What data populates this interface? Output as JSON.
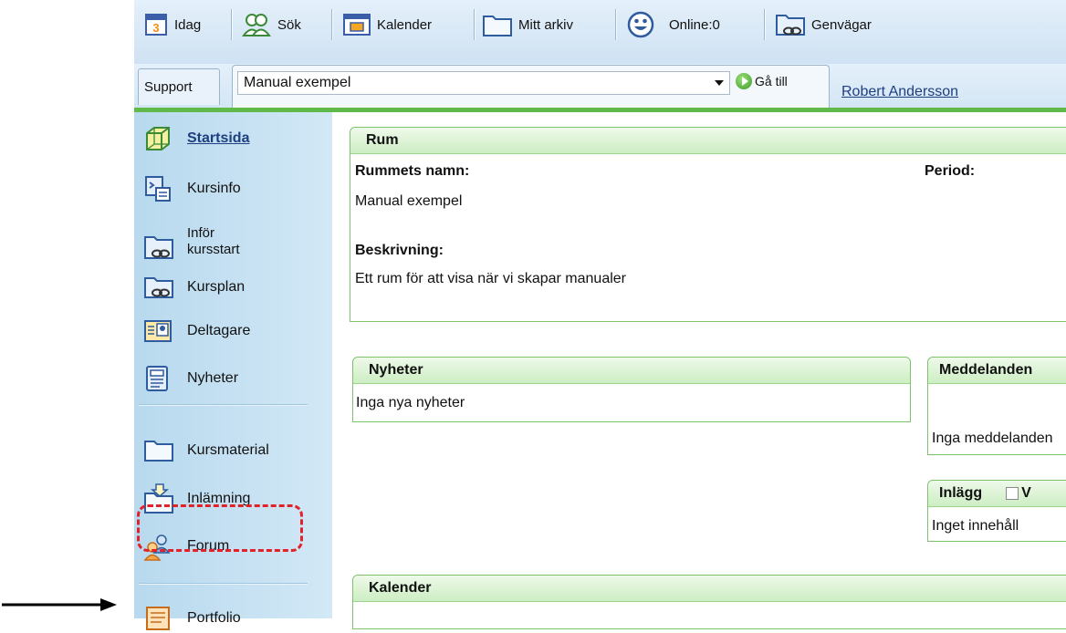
{
  "toolbar": {
    "items": [
      {
        "label": "Idag",
        "icon": "calendar-day-icon"
      },
      {
        "label": "Sök",
        "icon": "people-search-icon"
      },
      {
        "label": "Kalender",
        "icon": "calendar-icon"
      },
      {
        "label": "Mitt arkiv",
        "icon": "folder-icon"
      },
      {
        "label": "Online:0",
        "icon": "smiley-icon"
      },
      {
        "label": "Genvägar",
        "icon": "shortcut-folder-icon"
      }
    ],
    "calendar_day": "3"
  },
  "roombar": {
    "support_label": "Support",
    "room_value": "Manual exempel",
    "goto_label": "Gå till",
    "user_name": "Robert Andersson"
  },
  "sidebar": {
    "items": [
      {
        "label": "Startsida",
        "icon": "cube-icon"
      },
      {
        "label": "Kursinfo",
        "icon": "document-icon"
      },
      {
        "label": "Inför",
        "label2": "kursstart",
        "icon": "linked-folder-icon"
      },
      {
        "label": "Kursplan",
        "icon": "linked-folder-icon"
      },
      {
        "label": "Deltagare",
        "icon": "id-card-icon"
      },
      {
        "label": "Nyheter",
        "icon": "news-icon"
      },
      {
        "label": "Kursmaterial",
        "icon": "folder-icon"
      },
      {
        "label": "Inlämning",
        "icon": "upload-folder-icon"
      },
      {
        "label": "Forum",
        "icon": "forum-icon"
      },
      {
        "label": "Portfolio",
        "icon": "portfolio-icon"
      }
    ]
  },
  "rum": {
    "title": "Rum",
    "name_label": "Rummets namn:",
    "name_value": "Manual exempel",
    "period_label": "Period:",
    "desc_label": "Beskrivning:",
    "desc_value": "Ett rum för att visa när vi skapar manualer"
  },
  "nyheter": {
    "title": "Nyheter",
    "empty": "Inga nya nyheter"
  },
  "meddelanden": {
    "title": "Meddelanden",
    "empty": "Inga meddelanden"
  },
  "inlagg": {
    "title": "Inlägg",
    "checkbox_text": "V",
    "empty": "Inget innehåll"
  },
  "kalender": {
    "title": "Kalender"
  },
  "colors": {
    "accent_green": "#5fba4a",
    "sidebar_blue": "#c4e0f2",
    "link_blue": "#1e3f80",
    "highlight_red": "#e1222a"
  }
}
